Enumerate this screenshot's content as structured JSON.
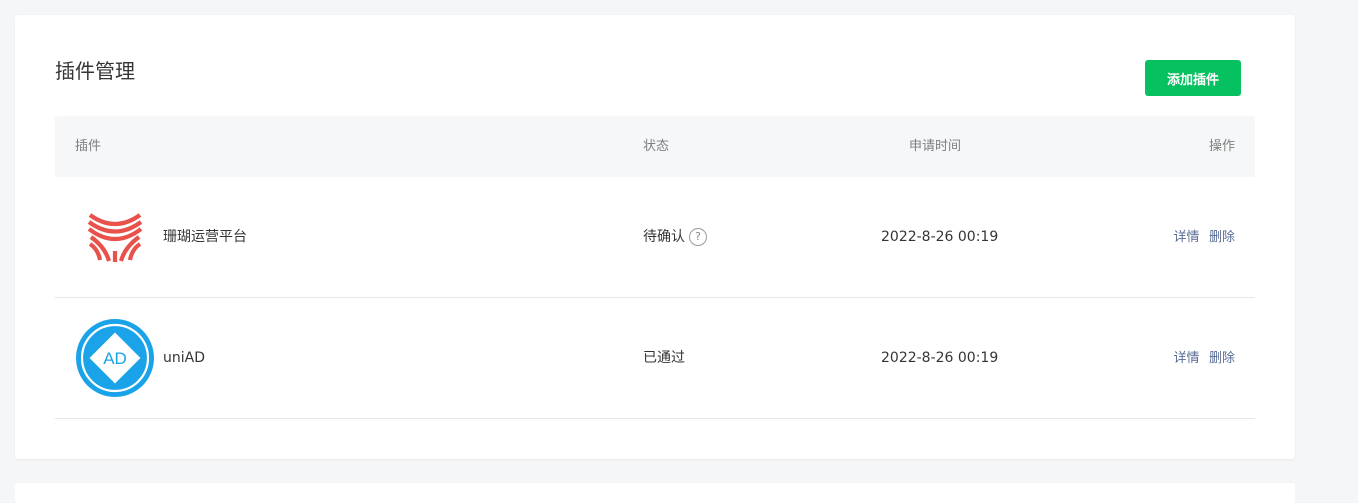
{
  "page": {
    "title": "插件管理",
    "add_button": "添加插件"
  },
  "colors": {
    "accent": "#07c160",
    "link": "#576b95",
    "coral_logo": "#e8524a",
    "uniad_logo": "#1aa3e8"
  },
  "table": {
    "headers": {
      "plugin": "插件",
      "status": "状态",
      "time": "申请时间",
      "ops": "操作"
    },
    "rows": [
      {
        "icon": "coral-logo-icon",
        "name": "珊瑚运营平台",
        "status": "待确认",
        "time": "2022-8-26 00:19",
        "detail": "详情",
        "delete": "删除"
      },
      {
        "icon": "uniad-logo-icon",
        "logo_text": "AD",
        "name": "uniAD",
        "status": "已通过",
        "time": "2022-8-26 00:19",
        "detail": "详情",
        "delete": "删除"
      }
    ]
  }
}
